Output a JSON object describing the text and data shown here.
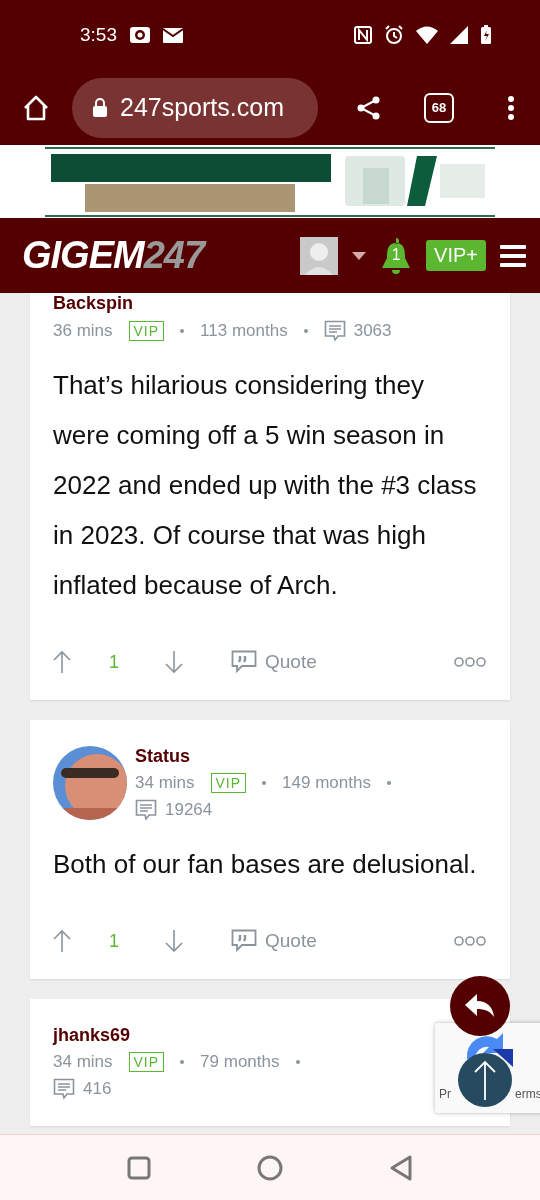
{
  "status_bar": {
    "time": "3:53"
  },
  "browser": {
    "url": "247sports.com",
    "tab_count": "68"
  },
  "site_header": {
    "logo_main": "GIGEM",
    "logo_suffix": "247",
    "notification_count": "1",
    "vip_button": "VIP+"
  },
  "posts": [
    {
      "author": "Backspin",
      "has_avatar": false,
      "time": "36 mins",
      "badge": "VIP",
      "tenure": "113 months",
      "post_count": "3063",
      "body": "That’s hilarious considering they were coming off a 5 win season in 2022 and ended up with the #3 class in 2023. Of course that was high inflated because of Arch.",
      "votes": "1",
      "action": "Quote"
    },
    {
      "author": "Status",
      "has_avatar": true,
      "time": "34 mins",
      "badge": "VIP",
      "tenure": "149 months",
      "post_count": "19264",
      "body": "Both of our fan bases are delusional.",
      "votes": "1",
      "action": "Quote"
    },
    {
      "author": "jhanks69",
      "has_avatar": false,
      "time": "34 mins",
      "badge": "VIP",
      "tenure": "79 months",
      "post_count": "416"
    }
  ],
  "recaptcha": {
    "left_text": "Pr",
    "right_text": "erms"
  }
}
